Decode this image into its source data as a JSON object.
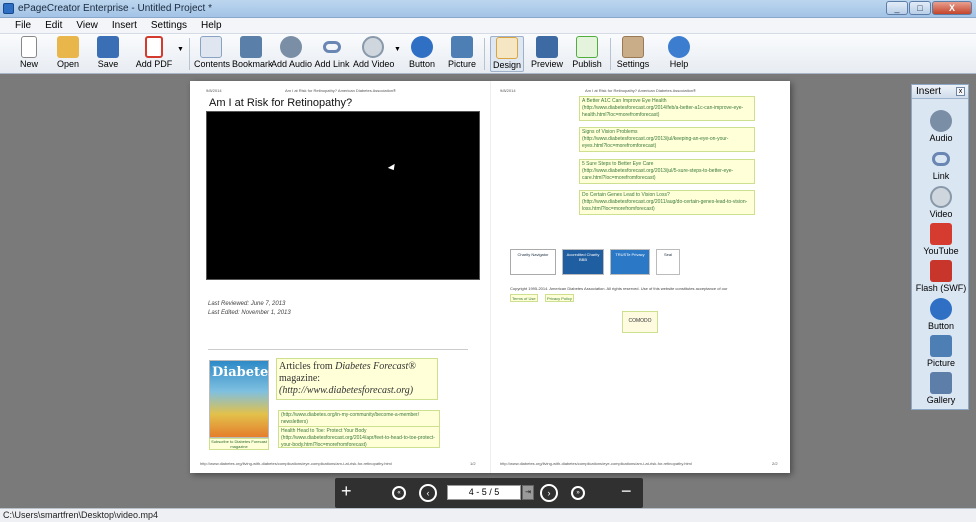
{
  "window": {
    "title": "ePageCreator Enterprise - Untitled Project *",
    "controls": [
      "_",
      "□",
      "X"
    ]
  },
  "menu": [
    "File",
    "Edit",
    "View",
    "Insert",
    "Settings",
    "Help"
  ],
  "toolbar": [
    {
      "label": "New",
      "icon": "new-document-icon",
      "color": "#f4f4f4"
    },
    {
      "label": "Open",
      "icon": "folder-open-icon",
      "color": "#e8b64b"
    },
    {
      "label": "Save",
      "icon": "floppy-disk-icon",
      "color": "#3b6fb5"
    },
    {
      "label": "Add PDF",
      "icon": "pdf-icon",
      "color": "#d43b2f"
    },
    {
      "label": "Contents",
      "icon": "contents-icon",
      "color": "#8aa3c4"
    },
    {
      "label": "Bookmark",
      "icon": "bookmark-icon",
      "color": "#5a7fa8"
    },
    {
      "label": "Add Audio",
      "icon": "speaker-icon",
      "color": "#7a8ea6"
    },
    {
      "label": "Add Link",
      "icon": "chain-link-icon",
      "color": "#6a86b2"
    },
    {
      "label": "Add Video",
      "icon": "film-reel-icon",
      "color": "#8899aa"
    },
    {
      "label": "Button",
      "icon": "button-icon",
      "color": "#2f6fc4"
    },
    {
      "label": "Picture",
      "icon": "picture-icon",
      "color": "#4d7fb5"
    },
    {
      "label": "Design",
      "icon": "design-pencil-icon",
      "color": "#d9a441"
    },
    {
      "label": "Preview",
      "icon": "preview-icon",
      "color": "#3d6aa3"
    },
    {
      "label": "Publish",
      "icon": "publish-arrow-icon",
      "color": "#4fae3d"
    },
    {
      "label": "Settings",
      "icon": "settings-gear-icon",
      "color": "#9a7a55"
    },
    {
      "label": "Help",
      "icon": "help-icon",
      "color": "#3d7dd0"
    }
  ],
  "left_page": {
    "header_date": "9/8/2014",
    "header_title": "Am I at Risk for Retinopathy? American Diabetes Association®",
    "title": "Am I at Risk for Retinopathy?",
    "last_reviewed": "Last Reviewed: June 7, 2013",
    "last_edited": "Last Edited: November 1, 2013",
    "magazine_cover_title": "Diabetes",
    "magazine_caption": "Subscribe to Diabetes Forecast magazine",
    "articles_heading_1": "Articles from ",
    "articles_heading_2": "Diabetes Forecast",
    "articles_heading_3": "® magazine:",
    "articles_url": "(http://www.diabetesforecast.org)",
    "link1": "(http://www.diabetes.org/in-my-community/become-a-member/",
    "link1b": "newsletters)",
    "link2": "Health Head to Toe: Protect Your Body",
    "link2b": "(http://www.diabetesforecast.org/2014/apr/feet-to-head-to-toe-protect-your-body.html?loc=morefromforecast)",
    "footer_url": "http://www.diabetes.org/living-with-diabetes/complications/eye-complications/am-i-at-risk-for-retinopathy.html",
    "footer_page": "1/2"
  },
  "right_page": {
    "header_date": "9/8/2014",
    "header_title": "Am I at Risk for Retinopathy? American Diabetes Association®",
    "links": [
      {
        "title": "A Better A1C Can Improve Eye Health",
        "url": "(http://www.diabetesforecast.org/2014/feb/a-better-a1c-can-improve-eye-health.html?loc=morefromforecast)"
      },
      {
        "title": "Signs of Vision Problems",
        "url": "(http://www.diabetesforecast.org/2013/jul/keeping-an-eye-on-your-eyes.html?loc=morefromforecast)"
      },
      {
        "title": "5 Sure Steps to Better Eye Care",
        "url": "(http://www.diabetesforecast.org/2013/jul/5-sure-steps-to-better-eye-care.html?loc=morefromforecast)"
      },
      {
        "title": "Do Certain Genes Lead to Vision Loss?",
        "url": "(http://www.diabetesforecast.org/2011/aug/do-certain-genes-lead-to-vision-loss.html?loc=morefromforecast)"
      }
    ],
    "badges": [
      "Charity Navigator",
      "Accredited Charity BBB",
      "TRUSTe Privacy",
      "Seal"
    ],
    "copyright": "Copyright 1995-2014. American Diabetes Association. All rights reserved. Use of this website constitutes acceptance of our",
    "terms_label": "Terms of Use",
    "privacy_label": "Privacy Policy",
    "comodo_label": "COMODO",
    "footer_url": "http://www.diabetes.org/living-with-diabetes/complications/eye-complications/am-i-at-risk-for-retinopathy.html",
    "footer_page": "2/2"
  },
  "navigation": {
    "page_indicator": "4 - 5 / 5",
    "go_label": "⇥",
    "first_label": "«",
    "prev_label": "‹",
    "next_label": "›",
    "last_label": "»",
    "zoom_in_label": "+",
    "zoom_out_label": "−"
  },
  "insert_panel": {
    "title": "Insert",
    "close_label": "x",
    "items": [
      {
        "label": "Audio",
        "icon": "speaker-icon",
        "color": "#7a8ea6"
      },
      {
        "label": "Link",
        "icon": "chain-link-icon",
        "color": "#6a86b2"
      },
      {
        "label": "Video",
        "icon": "film-reel-icon",
        "color": "#8899aa"
      },
      {
        "label": "YouTube",
        "icon": "youtube-icon",
        "color": "#d63b2f"
      },
      {
        "label": "Flash (SWF)",
        "icon": "flash-icon",
        "color": "#c8352a"
      },
      {
        "label": "Button",
        "icon": "button-icon",
        "color": "#2f6fc4"
      },
      {
        "label": "Picture",
        "icon": "picture-icon",
        "color": "#4d7fb5"
      },
      {
        "label": "Gallery",
        "icon": "gallery-camera-icon",
        "color": "#5c7ea8"
      }
    ]
  },
  "status_text": "C:\\Users\\smartfren\\Desktop\\video.mp4"
}
